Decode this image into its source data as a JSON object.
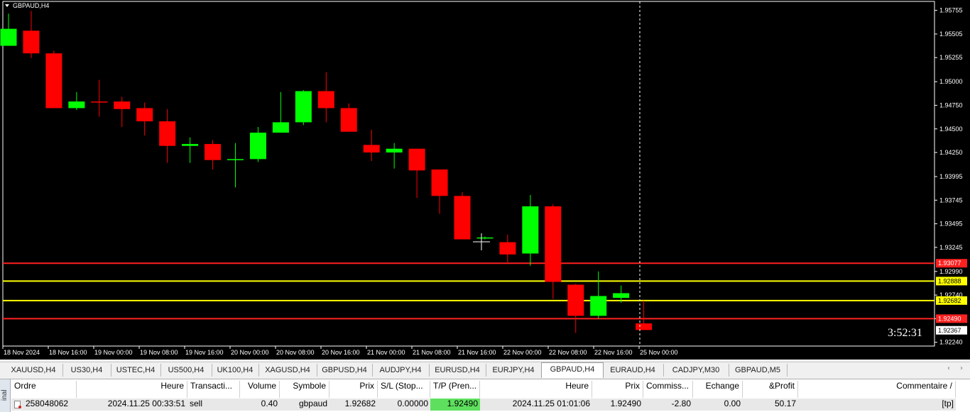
{
  "chart": {
    "title": "GBPAUD,H4",
    "countdown": "3:52:31",
    "colors": {
      "bull": "#00ff00",
      "bear": "#ff0000",
      "background": "#000000",
      "axis": "#ffffff",
      "ask_line": "#ff2020",
      "tp_line": "#ffff00"
    },
    "price_levels": [
      "1.95755",
      "1.95505",
      "1.95255",
      "1.95000",
      "1.94750",
      "1.94500",
      "1.94250",
      "1.93995",
      "1.93745",
      "1.93495",
      "1.93245",
      "1.92990",
      "1.92740",
      "1.92490",
      "1.92240"
    ],
    "time_labels": [
      "18 Nov 2024",
      "18 Nov 16:00",
      "19 Nov 00:00",
      "19 Nov 08:00",
      "19 Nov 16:00",
      "20 Nov 00:00",
      "20 Nov 08:00",
      "20 Nov 16:00",
      "21 Nov 00:00",
      "21 Nov 08:00",
      "21 Nov 16:00",
      "22 Nov 00:00",
      "22 Nov 08:00",
      "22 Nov 16:00",
      "25 Nov 00:00"
    ],
    "horizontal_lines": [
      {
        "price": 1.93077,
        "label": "1.93077",
        "color": "#ff2020"
      },
      {
        "price": 1.92888,
        "label": "1.92888",
        "color": "#ffff00"
      },
      {
        "price": 1.92682,
        "label": "1.92682",
        "color": "#ffff00"
      },
      {
        "price": 1.9249,
        "label": "1.92490",
        "color": "#ff2020"
      }
    ],
    "current_price_label": "1.92367",
    "vline_time": "25 Nov 00:00"
  },
  "chart_data": {
    "type": "candlestick",
    "title": "GBPAUD,H4",
    "ylim": [
      1.922,
      1.9585
    ],
    "candles": [
      {
        "o": 1.9538,
        "h": 1.9572,
        "l": 1.9538,
        "c": 1.9556
      },
      {
        "o": 1.9554,
        "h": 1.9575,
        "l": 1.9525,
        "c": 1.953
      },
      {
        "o": 1.953,
        "h": 1.9533,
        "l": 1.9472,
        "c": 1.9472
      },
      {
        "o": 1.9472,
        "h": 1.9489,
        "l": 1.947,
        "c": 1.9479
      },
      {
        "o": 1.9479,
        "h": 1.9502,
        "l": 1.9463,
        "c": 1.9478
      },
      {
        "o": 1.9479,
        "h": 1.9484,
        "l": 1.9452,
        "c": 1.9471
      },
      {
        "o": 1.9472,
        "h": 1.9478,
        "l": 1.9443,
        "c": 1.9458
      },
      {
        "o": 1.9458,
        "h": 1.9471,
        "l": 1.9414,
        "c": 1.9432
      },
      {
        "o": 1.9432,
        "h": 1.9441,
        "l": 1.9414,
        "c": 1.9434
      },
      {
        "o": 1.9434,
        "h": 1.9438,
        "l": 1.9407,
        "c": 1.9417
      },
      {
        "o": 1.9417,
        "h": 1.9435,
        "l": 1.9388,
        "c": 1.9418
      },
      {
        "o": 1.9418,
        "h": 1.9452,
        "l": 1.9415,
        "c": 1.9446
      },
      {
        "o": 1.9446,
        "h": 1.9489,
        "l": 1.9446,
        "c": 1.9457
      },
      {
        "o": 1.9457,
        "h": 1.9491,
        "l": 1.9454,
        "c": 1.949
      },
      {
        "o": 1.949,
        "h": 1.951,
        "l": 1.9457,
        "c": 1.9472
      },
      {
        "o": 1.9472,
        "h": 1.9477,
        "l": 1.9447,
        "c": 1.9447
      },
      {
        "o": 1.9433,
        "h": 1.9449,
        "l": 1.9416,
        "c": 1.9425
      },
      {
        "o": 1.9425,
        "h": 1.9435,
        "l": 1.9408,
        "c": 1.9429
      },
      {
        "o": 1.9429,
        "h": 1.9429,
        "l": 1.9377,
        "c": 1.9406
      },
      {
        "o": 1.9407,
        "h": 1.9407,
        "l": 1.936,
        "c": 1.9379
      },
      {
        "o": 1.9379,
        "h": 1.9383,
        "l": 1.9333,
        "c": 1.9333
      },
      {
        "o": 1.9334,
        "h": 1.9336,
        "l": 1.9333,
        "c": 1.9335
      },
      {
        "o": 1.933,
        "h": 1.9338,
        "l": 1.9308,
        "c": 1.9317
      },
      {
        "o": 1.9318,
        "h": 1.938,
        "l": 1.9305,
        "c": 1.9368
      },
      {
        "o": 1.9368,
        "h": 1.937,
        "l": 1.927,
        "c": 1.9288
      },
      {
        "o": 1.9285,
        "h": 1.9286,
        "l": 1.9234,
        "c": 1.9252
      },
      {
        "o": 1.9252,
        "h": 1.9299,
        "l": 1.9249,
        "c": 1.9273
      },
      {
        "o": 1.9271,
        "h": 1.9284,
        "l": 1.9266,
        "c": 1.9276
      },
      {
        "o": 1.9244,
        "h": 1.9268,
        "l": 1.9237,
        "c": 1.9237
      }
    ]
  },
  "tabs": [
    "XAUUSD,H4",
    "US30,H4",
    "USTEC,H4",
    "US500,H4",
    "UK100,H4",
    "XAGUSD,H4",
    "GBPUSD,H4",
    "AUDJPY,H4",
    "EURUSD,H4",
    "EURJPY,H4",
    "GBPAUD,H4",
    "EURAUD,H4",
    "CADJPY,M30",
    "GBPAUD,M5"
  ],
  "active_tab": "GBPAUD,H4",
  "terminal": {
    "side_label": "inal",
    "headers": [
      "Ordre",
      "Heure",
      "Transacti...",
      "Volume",
      "Symbole",
      "Prix",
      "S/L (Stop...",
      "T/P (Pren...",
      "Heure",
      "Prix",
      "Commiss...",
      "Echange",
      "&Profit",
      "Commentaire"
    ],
    "row": [
      "258048062",
      "2024.11.25 00:33:51",
      "sell",
      "0.40",
      "gbpaud",
      "1.92682",
      "0.00000",
      "1.92490",
      "2024.11.25 01:01:06",
      "1.92490",
      "-2.80",
      "0.00",
      "50.17",
      "[tp]"
    ]
  }
}
